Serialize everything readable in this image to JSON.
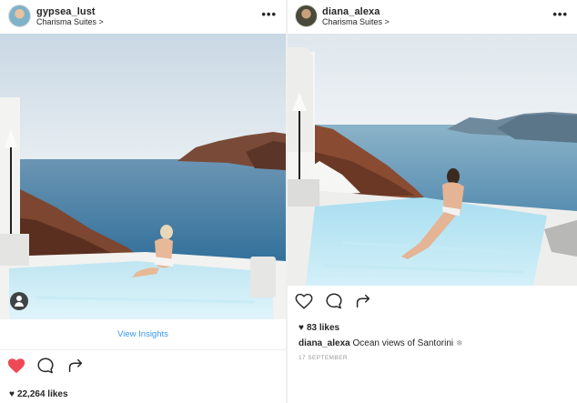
{
  "left_post": {
    "username": "gypsea_lust",
    "location": "Charisma Suites",
    "location_chevron": ">",
    "more": "•••",
    "insights_label": "View Insights",
    "likes": "22,264 likes",
    "liked": true,
    "like_color": "#ed4956"
  },
  "right_post": {
    "username": "diana_alexa",
    "location": "Charisma Suites",
    "location_chevron": ">",
    "more": "•••",
    "likes": "83 likes",
    "caption_user": "diana_alexa",
    "caption_text": "Ocean views of Santorini",
    "caption_emoji": "❄",
    "date": "17 SEPTEMBER"
  },
  "colors": {
    "link_blue": "#3897f0",
    "text": "#262626",
    "muted": "#999999"
  },
  "icons": [
    "heart-icon",
    "comment-icon",
    "share-icon",
    "user-tag-icon",
    "more-options-icon"
  ]
}
